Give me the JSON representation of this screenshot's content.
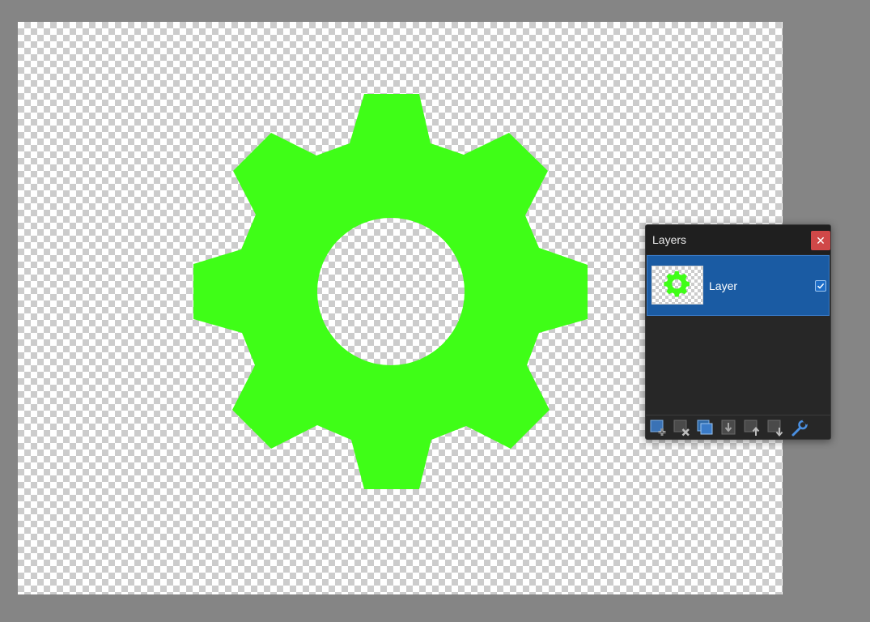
{
  "panel": {
    "title": "Layers",
    "close_label": "✕",
    "layers": [
      {
        "name": "Layer",
        "visible": true
      }
    ],
    "toolbar": [
      {
        "icon": "add-layer-icon"
      },
      {
        "icon": "delete-layer-icon"
      },
      {
        "icon": "duplicate-layer-icon"
      },
      {
        "icon": "merge-layer-down-icon"
      },
      {
        "icon": "move-layer-up-icon"
      },
      {
        "icon": "move-layer-down-icon"
      },
      {
        "icon": "layer-properties-icon"
      }
    ]
  },
  "colors": {
    "workspace": "#858585",
    "gear": "#3ffe17",
    "selection": "#1a5ba3",
    "close_button": "#d04848",
    "panel": "#272727"
  }
}
